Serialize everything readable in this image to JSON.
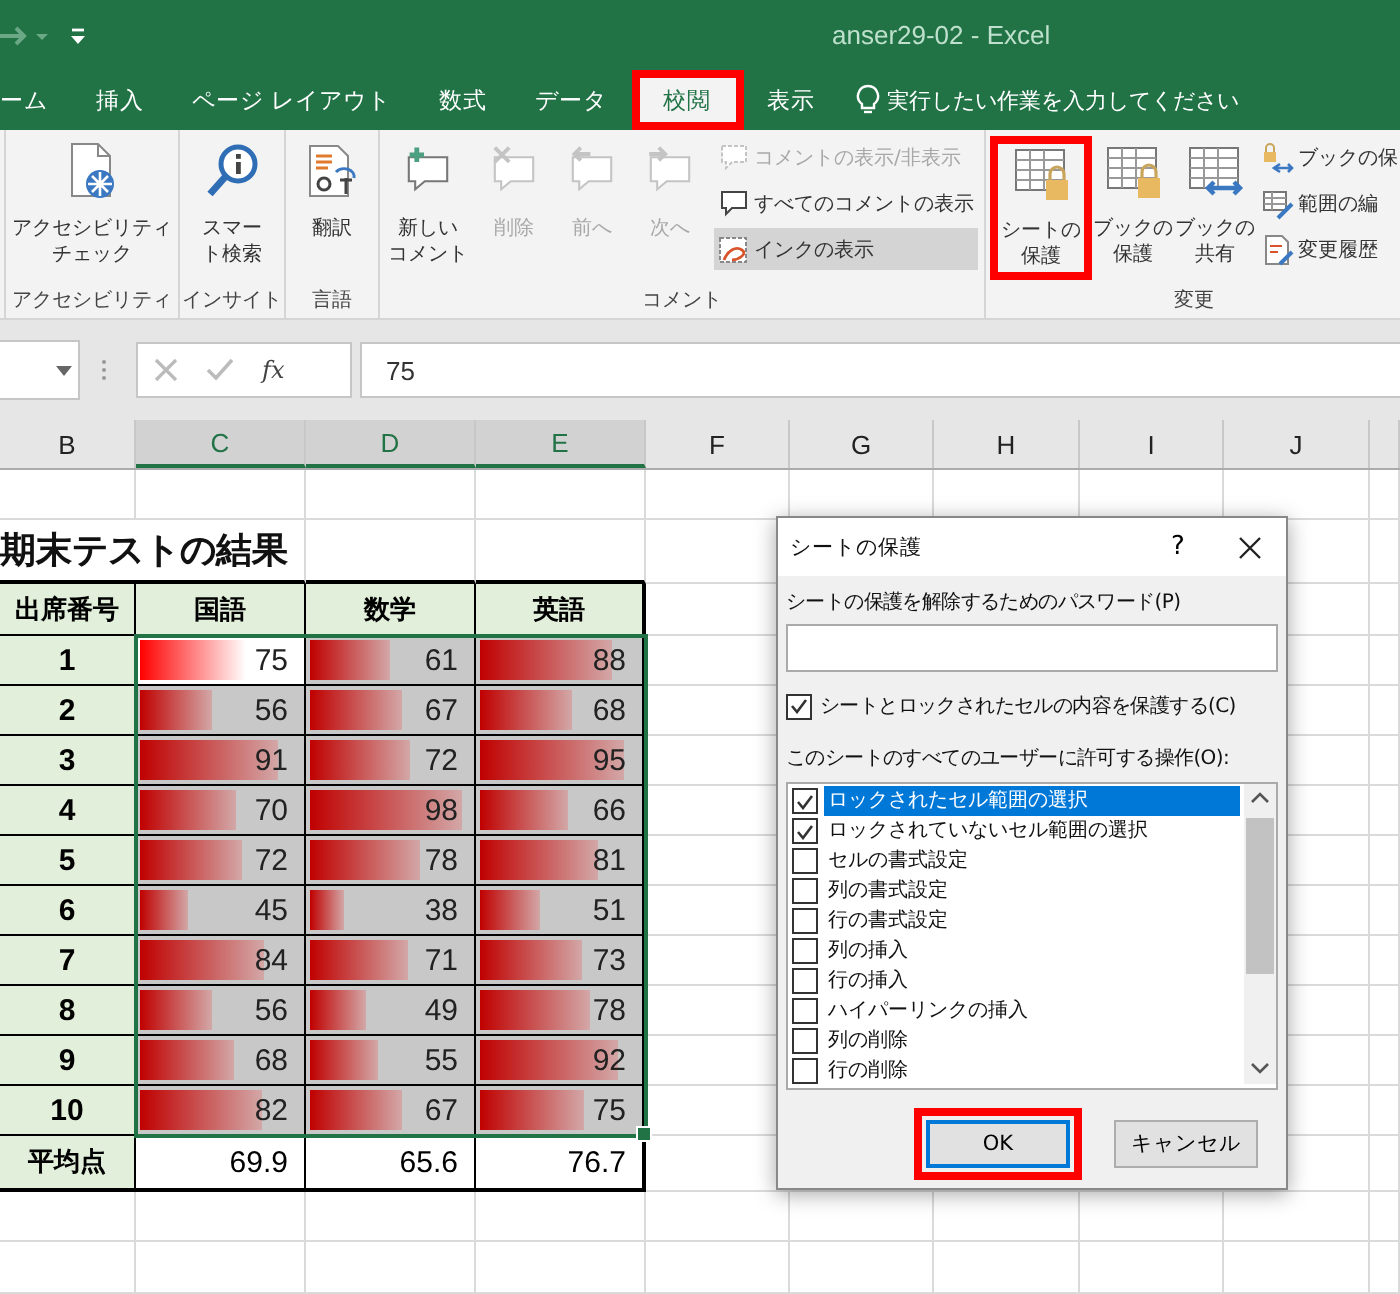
{
  "window": {
    "title": "anser29-02  -  Excel"
  },
  "ribbon_tabs": [
    {
      "label": "ーム",
      "selected": false,
      "highlighted": false
    },
    {
      "label": "挿入",
      "selected": false,
      "highlighted": false
    },
    {
      "label": "ページ レイアウト",
      "selected": false,
      "highlighted": false
    },
    {
      "label": "数式",
      "selected": false,
      "highlighted": false
    },
    {
      "label": "データ",
      "selected": false,
      "highlighted": false
    },
    {
      "label": "校閲",
      "selected": true,
      "highlighted": true
    },
    {
      "label": "表示",
      "selected": false,
      "highlighted": false
    }
  ],
  "tell_me": {
    "placeholder": "実行したい作業を入力してください"
  },
  "ribbon_groups": [
    {
      "label": "アクセシビリティ",
      "large_buttons": [
        {
          "label": [
            "アクセシビリティ",
            "チェック"
          ],
          "disabled": false,
          "highlighted": false
        }
      ]
    },
    {
      "label": "インサイト",
      "large_buttons": [
        {
          "label": [
            "スマー",
            "ト検索"
          ],
          "disabled": false,
          "highlighted": false
        }
      ]
    },
    {
      "label": "言語",
      "large_buttons": [
        {
          "label": [
            "翻訳"
          ],
          "disabled": false,
          "highlighted": false
        }
      ]
    },
    {
      "label": "コメント",
      "large_buttons": [
        {
          "label": [
            "新しい",
            "コメント"
          ],
          "disabled": false,
          "highlighted": false
        },
        {
          "label": [
            "削除"
          ],
          "disabled": true,
          "highlighted": false
        },
        {
          "label": [
            "前へ"
          ],
          "disabled": true,
          "highlighted": false
        },
        {
          "label": [
            "次へ"
          ],
          "disabled": true,
          "highlighted": false
        }
      ],
      "small_buttons": [
        {
          "label": "コメントの表示/非表示",
          "disabled": true,
          "pressed": false
        },
        {
          "label": "すべてのコメントの表示",
          "disabled": false,
          "pressed": false
        },
        {
          "label": "インクの表示",
          "disabled": false,
          "pressed": true
        }
      ]
    },
    {
      "label": "変更",
      "large_buttons": [
        {
          "label": [
            "シートの",
            "保護"
          ],
          "disabled": false,
          "highlighted": true
        },
        {
          "label": [
            "ブックの",
            "保護"
          ],
          "disabled": false,
          "highlighted": false
        },
        {
          "label": [
            "ブックの",
            "共有"
          ],
          "disabled": false,
          "highlighted": false
        }
      ],
      "small_buttons": [
        {
          "label": "ブックの保",
          "disabled": false,
          "pressed": false
        },
        {
          "label": "範囲の編",
          "disabled": false,
          "pressed": false
        },
        {
          "label": "変更履歴",
          "disabled": false,
          "pressed": false
        }
      ]
    }
  ],
  "formula_bar": {
    "function_label": "fx",
    "value": "75"
  },
  "column_headers": [
    {
      "label": "B",
      "selected": false
    },
    {
      "label": "C",
      "selected": true
    },
    {
      "label": "D",
      "selected": true
    },
    {
      "label": "E",
      "selected": true
    },
    {
      "label": "F",
      "selected": false
    },
    {
      "label": "G",
      "selected": false
    },
    {
      "label": "H",
      "selected": false
    },
    {
      "label": "I",
      "selected": false
    },
    {
      "label": "J",
      "selected": false
    }
  ],
  "sheet": {
    "title": "期末テストの結果",
    "columns": [
      "出席番号",
      "国語",
      "数学",
      "英語"
    ],
    "rows": [
      {
        "number": "1",
        "scores": [
          {
            "value": "75",
            "level": 0.67,
            "selected": true
          },
          {
            "value": "61",
            "level": 0.5,
            "selected": false
          },
          {
            "value": "88",
            "level": 0.84,
            "selected": false
          }
        ]
      },
      {
        "number": "2",
        "scores": [
          {
            "value": "56",
            "level": 0.45,
            "selected": false
          },
          {
            "value": "67",
            "level": 0.58,
            "selected": false
          },
          {
            "value": "68",
            "level": 0.59,
            "selected": false
          }
        ]
      },
      {
        "number": "3",
        "scores": [
          {
            "value": "91",
            "level": 0.87,
            "selected": false
          },
          {
            "value": "72",
            "level": 0.63,
            "selected": false
          },
          {
            "value": "95",
            "level": 0.92,
            "selected": false
          }
        ]
      },
      {
        "number": "4",
        "scores": [
          {
            "value": "70",
            "level": 0.61,
            "selected": false
          },
          {
            "value": "98",
            "level": 0.96,
            "selected": false
          },
          {
            "value": "66",
            "level": 0.56,
            "selected": false
          }
        ]
      },
      {
        "number": "5",
        "scores": [
          {
            "value": "72",
            "level": 0.64,
            "selected": false
          },
          {
            "value": "78",
            "level": 0.7,
            "selected": false
          },
          {
            "value": "81",
            "level": 0.75,
            "selected": false
          }
        ]
      },
      {
        "number": "6",
        "scores": [
          {
            "value": "45",
            "level": 0.31,
            "selected": false
          },
          {
            "value": "38",
            "level": 0.21,
            "selected": false
          },
          {
            "value": "51",
            "level": 0.38,
            "selected": false
          }
        ]
      },
      {
        "number": "7",
        "scores": [
          {
            "value": "84",
            "level": 0.79,
            "selected": false
          },
          {
            "value": "71",
            "level": 0.62,
            "selected": false
          },
          {
            "value": "73",
            "level": 0.65,
            "selected": false
          }
        ]
      },
      {
        "number": "8",
        "scores": [
          {
            "value": "56",
            "level": 0.45,
            "selected": false
          },
          {
            "value": "49",
            "level": 0.36,
            "selected": false
          },
          {
            "value": "78",
            "level": 0.71,
            "selected": false
          }
        ]
      },
      {
        "number": "9",
        "scores": [
          {
            "value": "68",
            "level": 0.59,
            "selected": false
          },
          {
            "value": "55",
            "level": 0.43,
            "selected": false
          },
          {
            "value": "92",
            "level": 0.89,
            "selected": false
          }
        ]
      },
      {
        "number": "10",
        "scores": [
          {
            "value": "82",
            "level": 0.77,
            "selected": false
          },
          {
            "value": "67",
            "level": 0.58,
            "selected": false
          },
          {
            "value": "75",
            "level": 0.67,
            "selected": false
          }
        ]
      }
    ],
    "average": {
      "label": "平均点",
      "values": [
        "69.9",
        "65.6",
        "76.7"
      ]
    }
  },
  "dialog": {
    "title": "シートの保護",
    "help": "?",
    "password_label": "シートの保護を解除するためのパスワード(P)",
    "protect_checkbox": {
      "label": "シートとロックされたセルの内容を保護する(C)",
      "checked": true
    },
    "permissions_label": "このシートのすべてのユーザーに許可する操作(O):",
    "permissions": [
      {
        "label": "ロックされたセル範囲の選択",
        "checked": true,
        "selected": true
      },
      {
        "label": "ロックされていないセル範囲の選択",
        "checked": true,
        "selected": false
      },
      {
        "label": "セルの書式設定",
        "checked": false,
        "selected": false
      },
      {
        "label": "列の書式設定",
        "checked": false,
        "selected": false
      },
      {
        "label": "行の書式設定",
        "checked": false,
        "selected": false
      },
      {
        "label": "列の挿入",
        "checked": false,
        "selected": false
      },
      {
        "label": "行の挿入",
        "checked": false,
        "selected": false
      },
      {
        "label": "ハイパーリンクの挿入",
        "checked": false,
        "selected": false
      },
      {
        "label": "列の削除",
        "checked": false,
        "selected": false
      },
      {
        "label": "行の削除",
        "checked": false,
        "selected": false
      }
    ],
    "buttons": [
      {
        "label": "OK",
        "default": true,
        "highlighted": true
      },
      {
        "label": "キャンセル",
        "default": false,
        "highlighted": false
      }
    ]
  }
}
